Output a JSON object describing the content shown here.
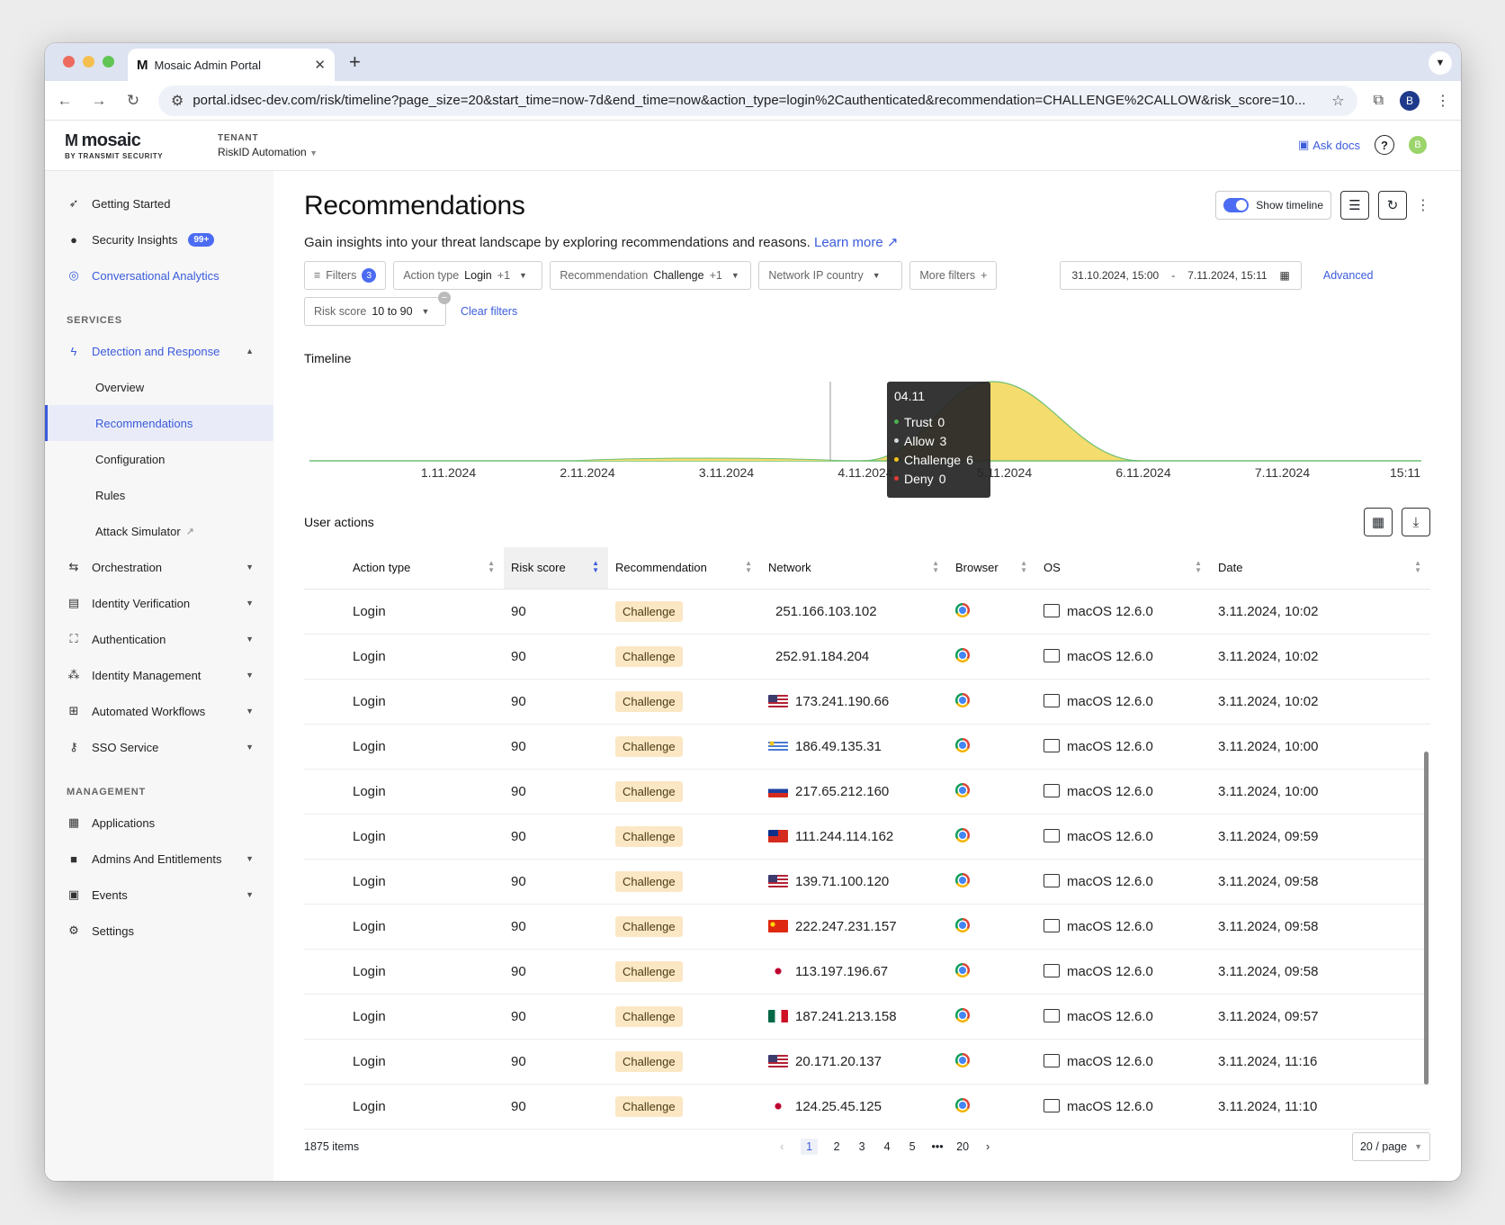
{
  "browser": {
    "tab_title": "Mosaic Admin Portal",
    "url": "portal.idsec-dev.com/risk/timeline?page_size=20&start_time=now-7d&end_time=now&action_type=login%2Cauthenticated&recommendation=CHALLENGE%2CALLOW&risk_score=10...",
    "profile_initial": "B"
  },
  "header": {
    "brand": "mosaic",
    "brand_sub": "BY TRANSMIT SECURITY",
    "tenant_label": "TENANT",
    "tenant_value": "RiskID Automation",
    "ask_docs": "Ask docs",
    "avatar_initial": "B"
  },
  "sidebar": {
    "top_items": [
      {
        "label": "Getting Started",
        "icon": "rocket-icon"
      },
      {
        "label": "Security Insights",
        "icon": "bulb-icon",
        "badge": "99+"
      },
      {
        "label": "Conversational Analytics",
        "icon": "analytics-icon"
      }
    ],
    "services_label": "SERVICES",
    "detection_label": "Detection and Response",
    "detection_children": [
      "Overview",
      "Recommendations",
      "Configuration",
      "Rules",
      "Attack Simulator"
    ],
    "services_items": [
      "Orchestration",
      "Identity Verification",
      "Authentication",
      "Identity Management",
      "Automated Workflows",
      "SSO Service"
    ],
    "management_label": "MANAGEMENT",
    "management_items": [
      "Applications",
      "Admins And Entitlements",
      "Events",
      "Settings"
    ]
  },
  "page": {
    "title": "Recommendations",
    "subtitle": "Gain insights into your threat landscape by exploring recommendations and reasons.",
    "learn_more": "Learn more",
    "show_timeline": "Show timeline"
  },
  "filters": {
    "filters_label": "Filters",
    "filters_count": "3",
    "action_type_label": "Action type",
    "action_type_value": "Login",
    "action_type_more": "+1",
    "recommendation_label": "Recommendation",
    "recommendation_value": "Challenge",
    "recommendation_more": "+1",
    "network_label": "Network IP country",
    "more_filters": "More filters",
    "date_start": "31.10.2024, 15:00",
    "date_sep": "-",
    "date_end": "7.11.2024, 15:11",
    "advanced": "Advanced",
    "risk_label": "Risk score",
    "risk_value": "10 to 90",
    "clear_filters": "Clear filters"
  },
  "timeline": {
    "title": "Timeline",
    "tooltip": {
      "date": "04.11",
      "rows": [
        {
          "label": "Trust",
          "value": "0",
          "color": "#4caf50"
        },
        {
          "label": "Allow",
          "value": "3",
          "color": "#cfd8dc"
        },
        {
          "label": "Challenge",
          "value": "6",
          "color": "#f5c518"
        },
        {
          "label": "Deny",
          "value": "0",
          "color": "#e53935"
        }
      ]
    }
  },
  "chart_data": {
    "type": "area",
    "x": [
      "1.11.2024",
      "2.11.2024",
      "3.11.2024",
      "4.11.2024",
      "5.11.2024",
      "6.11.2024",
      "7.11.2024",
      "15:11"
    ],
    "series": [
      {
        "name": "Challenge",
        "color": "#f5dc6e"
      }
    ]
  },
  "table": {
    "title": "User actions",
    "columns": [
      "Action type",
      "Risk score",
      "Recommendation",
      "Network",
      "Browser",
      "OS",
      "Date"
    ],
    "rows": [
      {
        "action": "Login",
        "score": "90",
        "rec": "Challenge",
        "flag": "",
        "ip": "251.166.103.102",
        "os": "macOS 12.6.0",
        "date": "3.11.2024, 10:02"
      },
      {
        "action": "Login",
        "score": "90",
        "rec": "Challenge",
        "flag": "",
        "ip": "252.91.184.204",
        "os": "macOS 12.6.0",
        "date": "3.11.2024, 10:02"
      },
      {
        "action": "Login",
        "score": "90",
        "rec": "Challenge",
        "flag": "us",
        "ip": "173.241.190.66",
        "os": "macOS 12.6.0",
        "date": "3.11.2024, 10:02"
      },
      {
        "action": "Login",
        "score": "90",
        "rec": "Challenge",
        "flag": "uy",
        "ip": "186.49.135.31",
        "os": "macOS 12.6.0",
        "date": "3.11.2024, 10:00"
      },
      {
        "action": "Login",
        "score": "90",
        "rec": "Challenge",
        "flag": "ru",
        "ip": "217.65.212.160",
        "os": "macOS 12.6.0",
        "date": "3.11.2024, 10:00"
      },
      {
        "action": "Login",
        "score": "90",
        "rec": "Challenge",
        "flag": "tw",
        "ip": "111.244.114.162",
        "os": "macOS 12.6.0",
        "date": "3.11.2024, 09:59"
      },
      {
        "action": "Login",
        "score": "90",
        "rec": "Challenge",
        "flag": "us",
        "ip": "139.71.100.120",
        "os": "macOS 12.6.0",
        "date": "3.11.2024, 09:58"
      },
      {
        "action": "Login",
        "score": "90",
        "rec": "Challenge",
        "flag": "cn",
        "ip": "222.247.231.157",
        "os": "macOS 12.6.0",
        "date": "3.11.2024, 09:58"
      },
      {
        "action": "Login",
        "score": "90",
        "rec": "Challenge",
        "flag": "jp",
        "ip": "113.197.196.67",
        "os": "macOS 12.6.0",
        "date": "3.11.2024, 09:58"
      },
      {
        "action": "Login",
        "score": "90",
        "rec": "Challenge",
        "flag": "mx",
        "ip": "187.241.213.158",
        "os": "macOS 12.6.0",
        "date": "3.11.2024, 09:57"
      },
      {
        "action": "Login",
        "score": "90",
        "rec": "Challenge",
        "flag": "us",
        "ip": "20.171.20.137",
        "os": "macOS 12.6.0",
        "date": "3.11.2024, 11:16"
      },
      {
        "action": "Login",
        "score": "90",
        "rec": "Challenge",
        "flag": "jp",
        "ip": "124.25.45.125",
        "os": "macOS 12.6.0",
        "date": "3.11.2024, 11:10"
      }
    ]
  },
  "pagination": {
    "total": "1875 items",
    "pages": [
      "1",
      "2",
      "3",
      "4",
      "5",
      "•••",
      "20"
    ],
    "current": "1",
    "page_size": "20 / page"
  }
}
